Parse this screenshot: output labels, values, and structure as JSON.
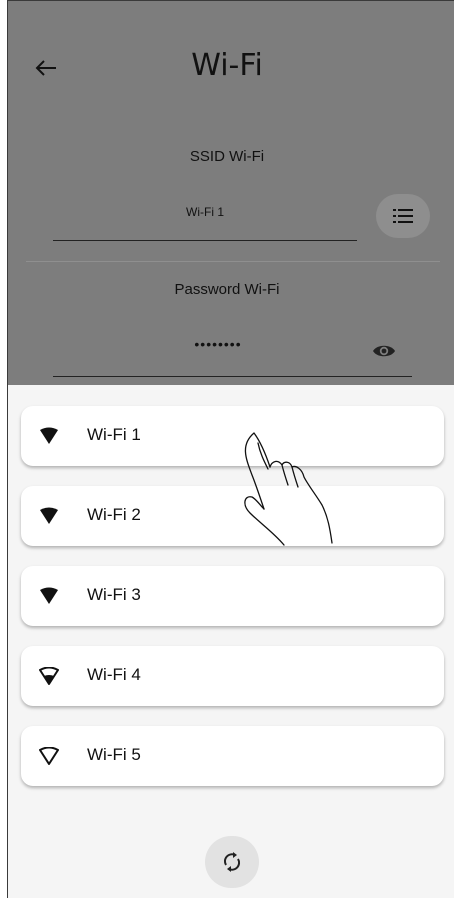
{
  "header": {
    "title": "Wi-Fi",
    "back_icon": "arrow-left-icon"
  },
  "form": {
    "ssid_label": "SSID Wi-Fi",
    "ssid_value": "Wi-Fi 1",
    "list_icon": "list-icon",
    "password_label": "Password Wi-Fi",
    "password_value": "••••••••",
    "visibility_icon": "eye-icon"
  },
  "networks": [
    {
      "name": "Wi-Fi 1",
      "signal": "full"
    },
    {
      "name": "Wi-Fi 2",
      "signal": "full"
    },
    {
      "name": "Wi-Fi 3",
      "signal": "full"
    },
    {
      "name": "Wi-Fi 4",
      "signal": "medium"
    },
    {
      "name": "Wi-Fi 5",
      "signal": "empty"
    }
  ],
  "footer": {
    "refresh_icon": "refresh-icon"
  },
  "colors": {
    "overlay": "#7d7d7d",
    "sheet_background": "#f5f5f5",
    "card_background": "#ffffff",
    "refresh_button": "#e2e2e2"
  }
}
